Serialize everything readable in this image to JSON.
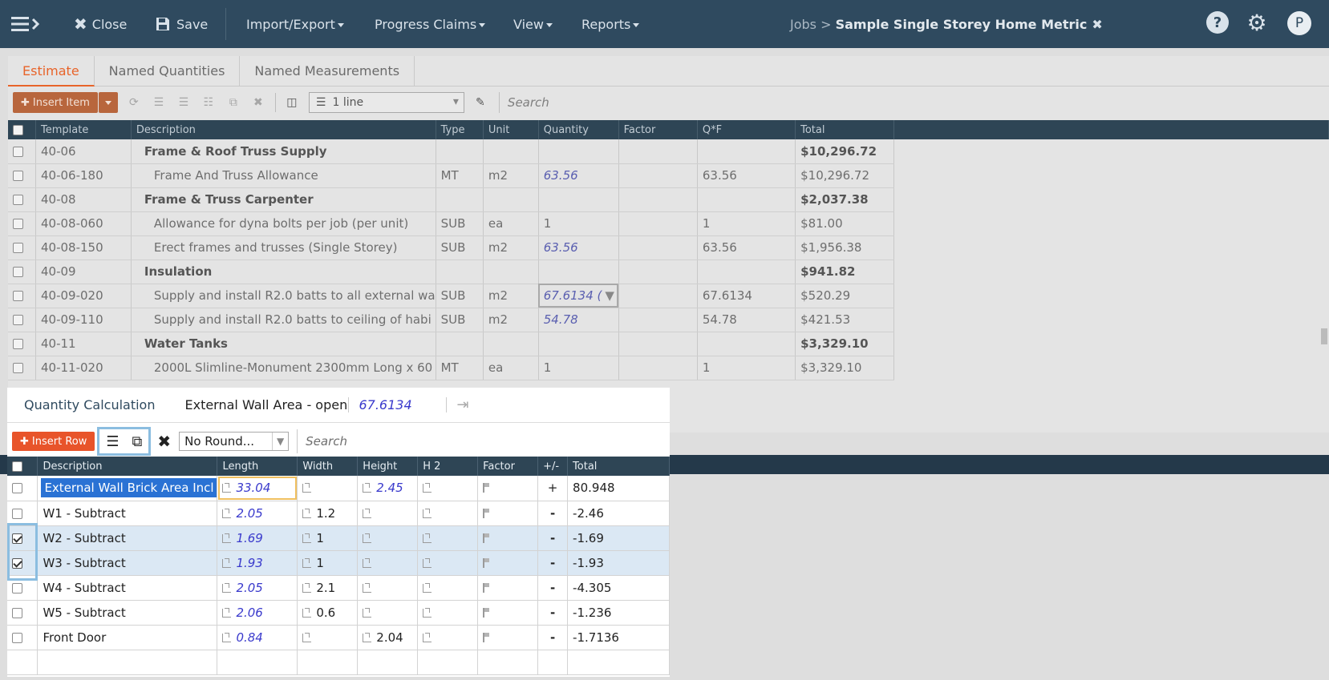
{
  "topbar": {
    "close_label": "Close",
    "save_label": "Save",
    "menus": [
      {
        "label": "Import/Export"
      },
      {
        "label": "Progress Claims"
      },
      {
        "label": "View"
      },
      {
        "label": "Reports"
      }
    ],
    "breadcrumb_prefix": "Jobs > ",
    "job_title": "Sample Single Storey Home Metric",
    "avatar_letter": "P"
  },
  "tabs": [
    {
      "label": "Estimate"
    },
    {
      "label": "Named Quantities"
    },
    {
      "label": "Named Measurements"
    }
  ],
  "toolbar": {
    "insert_item_label": "Insert Item",
    "lines_value": "1 line",
    "search_placeholder": "Search"
  },
  "estimate": {
    "columns": [
      "Template",
      "Description",
      "Type",
      "Unit",
      "Quantity",
      "Factor",
      "Q*F",
      "Total"
    ],
    "rows": [
      {
        "template": "40-06",
        "description": "Frame & Roof Truss Supply",
        "type": "",
        "unit": "",
        "quantity": "",
        "factor": "",
        "qf": "",
        "total": "$10,296.72"
      },
      {
        "template": "40-06-180",
        "description": "Frame And Truss Allowance",
        "type": "MT",
        "unit": "m2",
        "quantity": "63.56",
        "factor": "",
        "qf": "63.56",
        "total": "$10,296.72"
      },
      {
        "template": "40-08",
        "description": "Frame & Truss Carpenter",
        "type": "",
        "unit": "",
        "quantity": "",
        "factor": "",
        "qf": "",
        "total": "$2,037.38"
      },
      {
        "template": "40-08-060",
        "description": "Allowance for dyna bolts per job (per unit)",
        "type": "SUB",
        "unit": "ea",
        "quantity": "1",
        "factor": "",
        "qf": "1",
        "total": "$81.00"
      },
      {
        "template": "40-08-150",
        "description": "Erect frames and trusses (Single Storey)",
        "type": "SUB",
        "unit": "m2",
        "quantity": "63.56",
        "factor": "",
        "qf": "63.56",
        "total": "$1,956.38"
      },
      {
        "template": "40-09",
        "description": "Insulation",
        "type": "",
        "unit": "",
        "quantity": "",
        "factor": "",
        "qf": "",
        "total": "$941.82"
      },
      {
        "template": "40-09-020",
        "description": "Supply and install R2.0 batts to all external wa",
        "type": "SUB",
        "unit": "m2",
        "quantity": "67.6134 (",
        "factor": "",
        "qf": "67.6134",
        "total": "$520.29"
      },
      {
        "template": "40-09-110",
        "description": "Supply and install R2.0 batts to ceiling of habi",
        "type": "SUB",
        "unit": "m2",
        "quantity": "54.78",
        "factor": "",
        "qf": "54.78",
        "total": "$421.53"
      },
      {
        "template": "40-11",
        "description": "Water Tanks",
        "type": "",
        "unit": "",
        "quantity": "",
        "factor": "",
        "qf": "",
        "total": "$3,329.10"
      },
      {
        "template": "40-11-020",
        "description": "2000L Slimline-Monument 2300mm Long x 60",
        "type": "MT",
        "unit": "ea",
        "quantity": "1",
        "factor": "",
        "qf": "1",
        "total": "$3,329.10"
      }
    ]
  },
  "quantity_calc": {
    "title": "Quantity Calculation",
    "name": "External Wall Area - openir",
    "value": "67.6134",
    "insert_row_label": "Insert Row",
    "rounding_value": "No Round...",
    "search_placeholder": "Search",
    "columns": [
      "Description",
      "Length",
      "Width",
      "Height",
      "H 2",
      "Factor",
      "+/-",
      "Total"
    ],
    "rows": [
      {
        "description": "External Wall Brick Area Incl",
        "length": "33.04",
        "width": "",
        "height": "2.45",
        "h2": "",
        "sign": "+",
        "total": "80.948",
        "checked": false
      },
      {
        "description": "W1 - Subtract",
        "length": "2.05",
        "width": "1.2",
        "height": "",
        "h2": "",
        "sign": "-",
        "total": "-2.46",
        "checked": false
      },
      {
        "description": "W2 - Subtract",
        "length": "1.69",
        "width": "1",
        "height": "",
        "h2": "",
        "sign": "-",
        "total": "-1.69",
        "checked": true
      },
      {
        "description": "W3 - Subtract",
        "length": "1.93",
        "width": "1",
        "height": "",
        "h2": "",
        "sign": "-",
        "total": "-1.93",
        "checked": true
      },
      {
        "description": "W4 - Subtract",
        "length": "2.05",
        "width": "2.1",
        "height": "",
        "h2": "",
        "sign": "-",
        "total": "-4.305",
        "checked": false
      },
      {
        "description": "W5 - Subtract",
        "length": "2.06",
        "width": "0.6",
        "height": "",
        "h2": "",
        "sign": "-",
        "total": "-1.236",
        "checked": false
      },
      {
        "description": "Front Door",
        "length": "0.84",
        "width": "",
        "height": "2.04",
        "h2": "",
        "sign": "-",
        "total": "-1.7136",
        "checked": false
      }
    ]
  },
  "colors": {
    "topbar": "#2f4a5f",
    "accent": "#e8542a",
    "header": "#2e4555",
    "selection": "#dbe8f4",
    "highlight": "#8bbde0"
  }
}
